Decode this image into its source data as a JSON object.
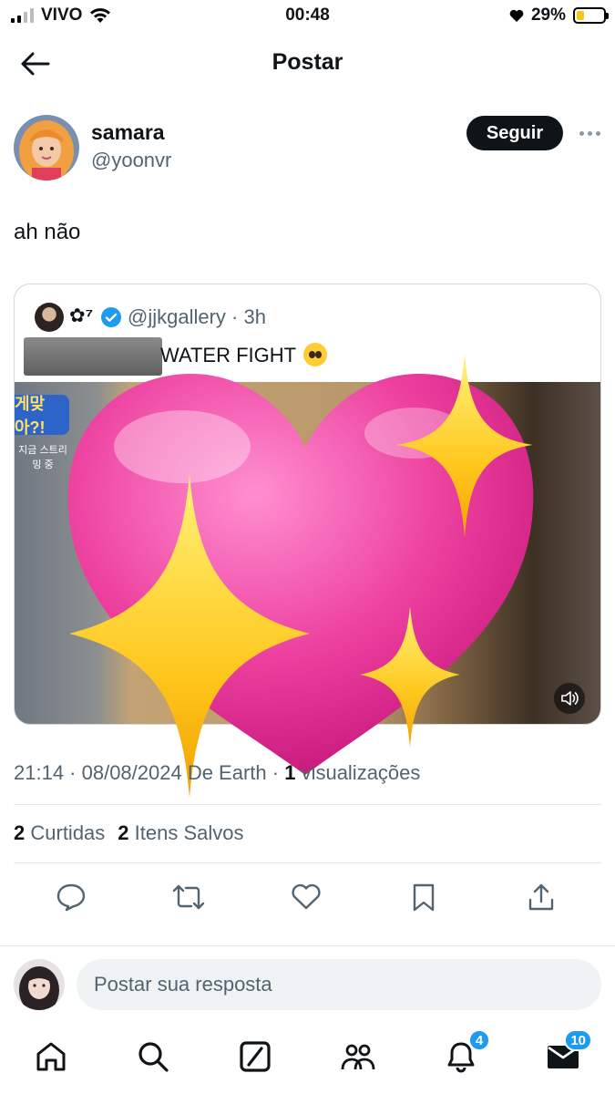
{
  "status_bar": {
    "carrier": "VIVO",
    "time": "00:48",
    "battery": "29%",
    "battery_level": 0.29
  },
  "header": {
    "title": "Postar"
  },
  "post": {
    "author_name": "samara",
    "author_handle": "@yoonvr",
    "follow_label": "Seguir",
    "text": "ah não",
    "timestamp": "21:14 · 08/08/2024 De Earth · ",
    "views_count": "1",
    "views_label": " visualizações"
  },
  "quote": {
    "author_name": "✿⁷",
    "author_handle": "@jjkgallery · 3h",
    "text": "WATER FIGHT",
    "emoji": "pleading-face-emoji",
    "media_logo": "게맞아?!",
    "media_caption": "지금 스트리밍 중"
  },
  "stats": {
    "likes_count": "2",
    "likes_label": "Curtidas",
    "bookmarks_count": "2",
    "bookmarks_label": "Itens Salvos"
  },
  "reply": {
    "placeholder": "Postar sua resposta"
  },
  "tabbar": {
    "notifications_badge": "4",
    "messages_badge": "10"
  },
  "colors": {
    "accent": "#1d9bf0",
    "text_primary": "#0f1419",
    "text_secondary": "#536471",
    "heart_pink": "#ec3f9e",
    "sparkle_yellow": "#ffd42a"
  }
}
